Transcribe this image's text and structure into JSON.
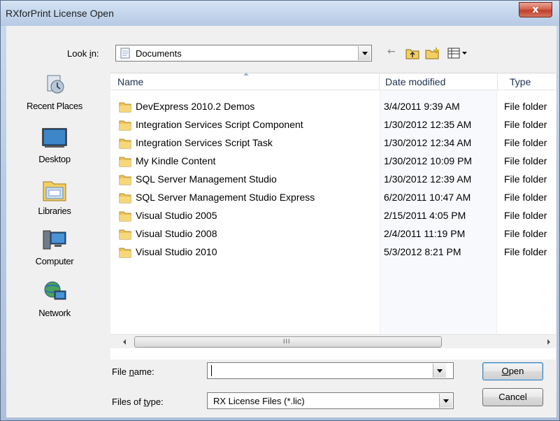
{
  "window": {
    "title": "RXforPrint License Open",
    "close_glyph": "x"
  },
  "toolbar": {
    "look_in_label_pre": "Look ",
    "look_in_label_accel": "i",
    "look_in_label_post": "n:",
    "look_in_value": "Documents",
    "icons": [
      "back-arrow-icon",
      "up-folder-icon",
      "new-folder-icon",
      "view-menu-icon"
    ]
  },
  "places": [
    {
      "label": "Recent Places",
      "icon": "recent-places-icon"
    },
    {
      "label": "Desktop",
      "icon": "desktop-icon"
    },
    {
      "label": "Libraries",
      "icon": "libraries-icon"
    },
    {
      "label": "Computer",
      "icon": "computer-icon"
    },
    {
      "label": "Network",
      "icon": "network-icon"
    }
  ],
  "columns": {
    "name": "Name",
    "date": "Date modified",
    "type": "Type"
  },
  "files": [
    {
      "name": "DevExpress 2010.2 Demos",
      "date": "3/4/2011 9:39 AM",
      "type": "File folder"
    },
    {
      "name": "Integration Services Script Component",
      "date": "1/30/2012 12:35 AM",
      "type": "File folder"
    },
    {
      "name": "Integration Services Script Task",
      "date": "1/30/2012 12:34 AM",
      "type": "File folder"
    },
    {
      "name": "My Kindle Content",
      "date": "1/30/2012 10:09 PM",
      "type": "File folder"
    },
    {
      "name": "SQL Server Management Studio",
      "date": "1/30/2012 12:39 AM",
      "type": "File folder"
    },
    {
      "name": "SQL Server Management Studio Express",
      "date": "6/20/2011 10:47 AM",
      "type": "File folder"
    },
    {
      "name": "Visual Studio 2005",
      "date": "2/15/2011 4:05 PM",
      "type": "File folder"
    },
    {
      "name": "Visual Studio 2008",
      "date": "2/4/2011 11:19 PM",
      "type": "File folder"
    },
    {
      "name": "Visual Studio 2010",
      "date": "5/3/2012 8:21 PM",
      "type": "File folder"
    }
  ],
  "scrollbar": {
    "grip": "III"
  },
  "bottom": {
    "file_name_label_pre": "File ",
    "file_name_label_accel": "n",
    "file_name_label_post": "ame:",
    "file_name_value": "",
    "file_type_label_pre": "Files of ",
    "file_type_label_accel": "t",
    "file_type_label_post": "ype:",
    "file_type_value": "RX License Files (*.lic)",
    "open_accel": "O",
    "open_rest": "pen",
    "cancel_label": "Cancel"
  },
  "colors": {
    "accent": "#3c7fb1",
    "folder": "#e8b84a",
    "close": "#c0402b"
  }
}
